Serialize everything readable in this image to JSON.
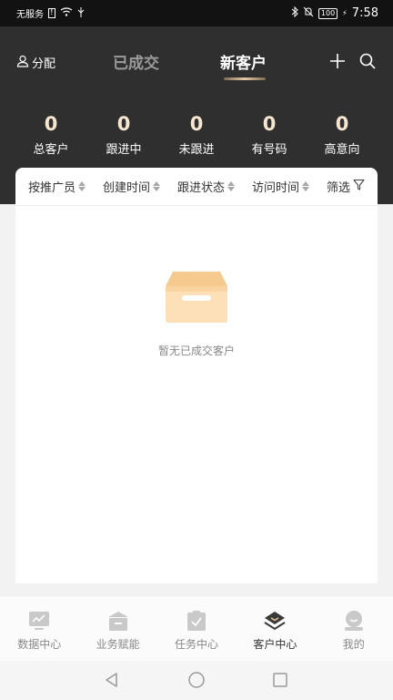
{
  "statusbar": {
    "carrier": "无服务",
    "battery": "100",
    "time": "7:58"
  },
  "header": {
    "assign_label": "分配",
    "tabs": [
      {
        "label": "已成交",
        "active": false
      },
      {
        "label": "新客户",
        "active": true
      }
    ],
    "plus_icon": "plus-icon",
    "search_icon": "search-icon"
  },
  "stats": [
    {
      "value": "0",
      "label": "总客户"
    },
    {
      "value": "0",
      "label": "跟进中"
    },
    {
      "value": "0",
      "label": "未跟进"
    },
    {
      "value": "0",
      "label": "有号码"
    },
    {
      "value": "0",
      "label": "高意向"
    }
  ],
  "filters": [
    {
      "label": "按推广员"
    },
    {
      "label": "创建时间"
    },
    {
      "label": "跟进状态"
    },
    {
      "label": "访问时间"
    }
  ],
  "filter_button": "筛选",
  "empty_state": {
    "text": "暂无已成交客户"
  },
  "bottom_nav": [
    {
      "label": "数据中心",
      "icon": "chart-icon",
      "active": false
    },
    {
      "label": "业务赋能",
      "icon": "store-icon",
      "active": false
    },
    {
      "label": "任务中心",
      "icon": "clipboard-icon",
      "active": false
    },
    {
      "label": "客户中心",
      "icon": "layers-icon",
      "active": true
    },
    {
      "label": "我的",
      "icon": "profile-icon",
      "active": false
    }
  ],
  "colors": {
    "header_bg": "#2f2f2f",
    "accent_gold": "#f6e6cf",
    "empty_box": "#f9d9ad"
  }
}
